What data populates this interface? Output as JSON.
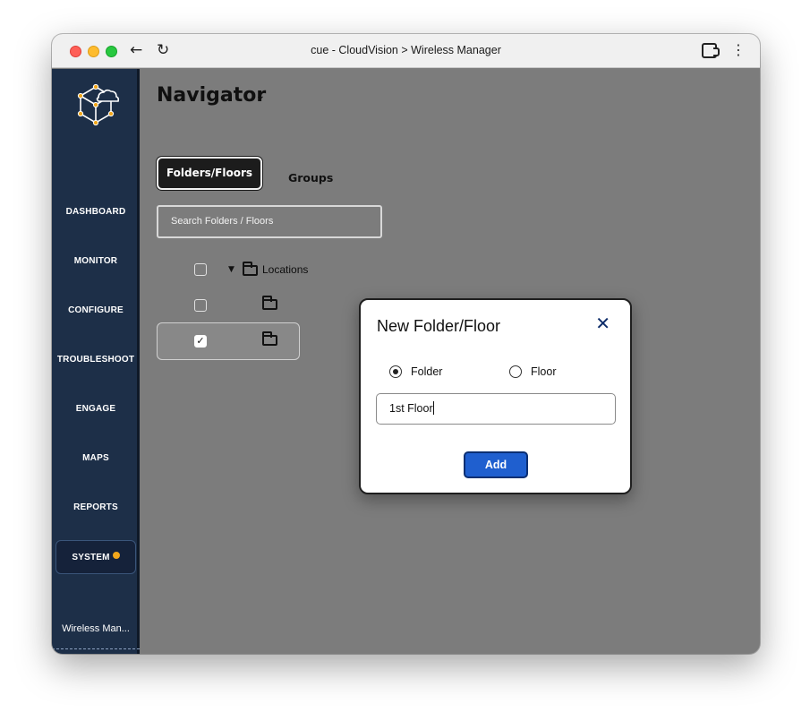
{
  "window": {
    "title": "cue - CloudVision > Wireless Manager"
  },
  "sidebar": {
    "items": [
      {
        "label": "DASHBOARD"
      },
      {
        "label": "MONITOR"
      },
      {
        "label": "CONFIGURE"
      },
      {
        "label": "TROUBLESHOOT"
      },
      {
        "label": "ENGAGE"
      },
      {
        "label": "MAPS"
      },
      {
        "label": "REPORTS"
      },
      {
        "label": "SYSTEM"
      }
    ],
    "app_label": "Wireless Man..."
  },
  "navigator": {
    "title": "Navigator",
    "tabs": [
      {
        "label": "Folders/Floors"
      },
      {
        "label": "Groups"
      }
    ],
    "search": {
      "placeholder": "Search Folders / Floors"
    },
    "tree": {
      "root_label": "Locations"
    }
  },
  "modal": {
    "title": "New Folder/Floor",
    "options": [
      {
        "label": "Folder"
      },
      {
        "label": "Floor"
      }
    ],
    "selected_option": "Folder",
    "input_value": "1st Floor",
    "add_label": "Add"
  },
  "colors": {
    "sidebar_bg": "#1d2f48",
    "overlay_bg": "#7c7c7c",
    "add_button": "#1f5fcf",
    "system_badge": "#f2a71b"
  }
}
